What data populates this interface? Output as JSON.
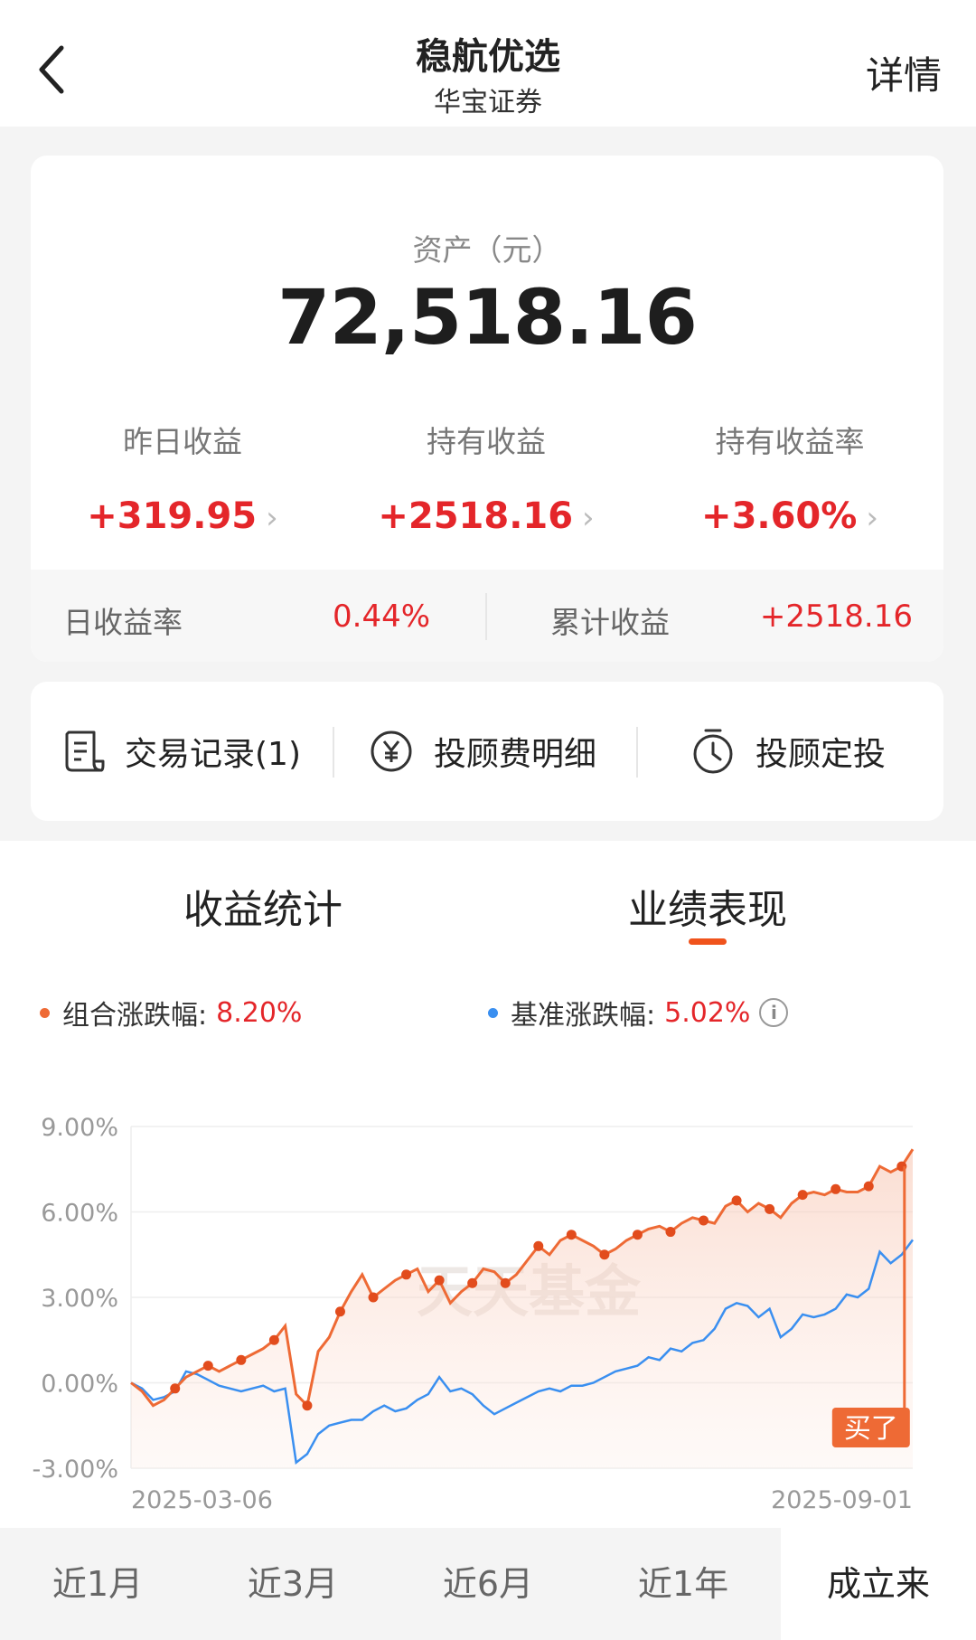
{
  "header": {
    "title": "稳航优选",
    "subtitle": "华宝证券",
    "detail_label": "详情"
  },
  "asset": {
    "label": "资产（元）",
    "value": "72,518.16"
  },
  "stats": [
    {
      "label": "昨日收益",
      "value": "+319.95"
    },
    {
      "label": "持有收益",
      "value": "+2518.16"
    },
    {
      "label": "持有收益率",
      "value": "+3.60%"
    }
  ],
  "subbar": {
    "daily_rate_label": "日收益率",
    "daily_rate_value": "0.44%",
    "cum_label": "累计收益",
    "cum_value": "+2518.16"
  },
  "actions": [
    {
      "label": "交易记录(1)",
      "icon": "receipt-icon"
    },
    {
      "label": "投顾费明细",
      "icon": "yen-circle-icon"
    },
    {
      "label": "投顾定投",
      "icon": "timer-icon"
    }
  ],
  "tabs": [
    {
      "label": "收益统计",
      "active": false
    },
    {
      "label": "业绩表现",
      "active": true
    }
  ],
  "legend": {
    "portfolio_label": "组合涨跌幅:",
    "portfolio_value": "8.20%",
    "benchmark_label": "基准涨跌幅:",
    "benchmark_value": "5.02%"
  },
  "colors": {
    "accent": "#f0531c",
    "portfolio": "#ee6a35",
    "benchmark": "#3a8ff0",
    "up_red": "#e4262a"
  },
  "chart_data": {
    "type": "line",
    "watermark": "天天基金",
    "yticks": [
      "9.00%",
      "6.00%",
      "3.00%",
      "0.00%",
      "-3.00%"
    ],
    "ylim": [
      -3,
      9
    ],
    "xticks": [
      "2025-03-06",
      "2025-09-01"
    ],
    "buy_marker": "买了",
    "series": [
      {
        "name": "组合涨跌幅",
        "values": [
          0.0,
          -0.3,
          -0.8,
          -0.6,
          -0.2,
          0.2,
          0.4,
          0.6,
          0.4,
          0.6,
          0.8,
          1.0,
          1.2,
          1.5,
          2.0,
          -0.4,
          -0.8,
          1.1,
          1.6,
          2.5,
          3.2,
          3.8,
          3.0,
          3.3,
          3.6,
          3.8,
          4.0,
          3.2,
          3.6,
          2.8,
          3.2,
          3.5,
          4.0,
          3.9,
          3.5,
          3.8,
          4.3,
          4.8,
          4.5,
          5.0,
          5.2,
          5.0,
          4.8,
          4.5,
          4.7,
          5.0,
          5.2,
          5.4,
          5.5,
          5.3,
          5.6,
          5.8,
          5.7,
          5.6,
          6.2,
          6.4,
          6.0,
          6.3,
          6.1,
          5.8,
          6.3,
          6.6,
          6.7,
          6.6,
          6.8,
          6.7,
          6.7,
          6.9,
          7.6,
          7.4,
          7.6,
          8.2
        ]
      },
      {
        "name": "基准涨跌幅",
        "values": [
          0.0,
          -0.2,
          -0.6,
          -0.5,
          -0.3,
          0.4,
          0.3,
          0.1,
          -0.1,
          -0.2,
          -0.3,
          -0.2,
          -0.1,
          -0.3,
          -0.2,
          -2.8,
          -2.5,
          -1.8,
          -1.5,
          -1.4,
          -1.3,
          -1.3,
          -1.0,
          -0.8,
          -1.0,
          -0.9,
          -0.6,
          -0.4,
          0.2,
          -0.3,
          -0.2,
          -0.4,
          -0.8,
          -1.1,
          -0.9,
          -0.7,
          -0.5,
          -0.3,
          -0.2,
          -0.3,
          -0.1,
          -0.1,
          0.0,
          0.2,
          0.4,
          0.5,
          0.6,
          0.9,
          0.8,
          1.2,
          1.1,
          1.4,
          1.5,
          1.9,
          2.6,
          2.8,
          2.7,
          2.3,
          2.6,
          1.6,
          1.9,
          2.4,
          2.3,
          2.4,
          2.6,
          3.1,
          3.0,
          3.3,
          4.6,
          4.2,
          4.5,
          5.02
        ]
      }
    ]
  },
  "periods": [
    {
      "label": "近1月",
      "active": false
    },
    {
      "label": "近3月",
      "active": false
    },
    {
      "label": "近6月",
      "active": false
    },
    {
      "label": "近1年",
      "active": false
    },
    {
      "label": "成立来",
      "active": true
    }
  ]
}
